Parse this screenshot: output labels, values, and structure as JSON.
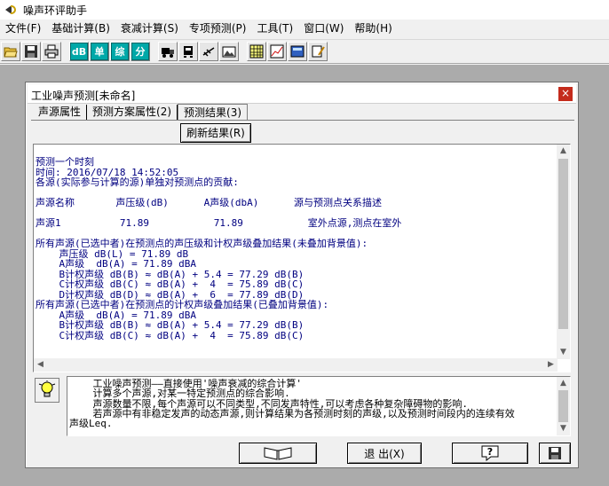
{
  "app": {
    "title": "噪声环评助手"
  },
  "menu": {
    "items": [
      {
        "label": "文件(F)"
      },
      {
        "label": "基础计算(B)"
      },
      {
        "label": "衰减计算(S)"
      },
      {
        "label": "专项预测(P)"
      },
      {
        "label": "工具(T)"
      },
      {
        "label": "窗口(W)"
      },
      {
        "label": "帮助(H)"
      }
    ]
  },
  "toolbar": {
    "text_buttons": {
      "db": "dB",
      "single": "单",
      "combined": "综",
      "score": "分"
    },
    "accent_color": "#00a8a8",
    "icons": [
      "open-icon",
      "save-icon",
      "print-icon",
      "truck-icon",
      "vehicle-icon",
      "airplane-icon",
      "image-icon",
      "grid-icon",
      "line-chart-icon",
      "calculator-icon",
      "note-icon"
    ]
  },
  "window": {
    "title": "工业噪声预测[未命名]",
    "close": "×",
    "tabs": [
      {
        "label": "声源属性"
      },
      {
        "label": "预测方案属性(2)"
      },
      {
        "label": "预测结果(3)"
      }
    ],
    "refresh_button": "刷新结果(R)",
    "results_text": "预测一个时刻\n时间: 2016/07/18 14:52:05\n各源(实际参与计算的源)单独对预测点的贡献:\n\n声源名称       声压级(dB)      A声级(dbA)      源与预测点关系描述\n\n声源1          71.89           71.89           室外点源,测点在室外\n\n所有声源(已选中者)在预测点的声压级和计权声级叠加结果(未叠加背景值):\n    声压级 dB(L) = 71.89 dB\n    A声级  dB(A) = 71.89 dBA\n    B计权声级 dB(B) ≈ dB(A) + 5.4 = 77.29 dB(B)\n    C计权声级 dB(C) ≈ dB(A) +  4  = 75.89 dB(C)\n    D计权声级 dB(D) ≈ dB(A) +  6  = 77.89 dB(D)\n所有声源(已选中者)在预测点的计权声级叠加结果(已叠加背景值):\n    A声级  dB(A) = 71.89 dBA\n    B计权声级 dB(B) ≈ dB(A) + 5.4 = 77.29 dB(B)\n    C计权声级 dB(C) ≈ dB(A) +  4  = 75.89 dB(C)",
    "hint_text": "    工业噪声预测——直接使用'噪声衰减的综合计算'\n    计算多个声源,对某一特定预测点的综合影响.\n    声源数量不限,每个声源可以不同类型,不同发声特性,可以考虑各种复杂障碍物的影响.\n    若声源中有非稳定发声的动态声源,则计算结果为各预测时刻的声级,以及预测时间段内的连续有效\n声级Leq.",
    "exit_button": "退 出(X)",
    "help_button": "?"
  }
}
